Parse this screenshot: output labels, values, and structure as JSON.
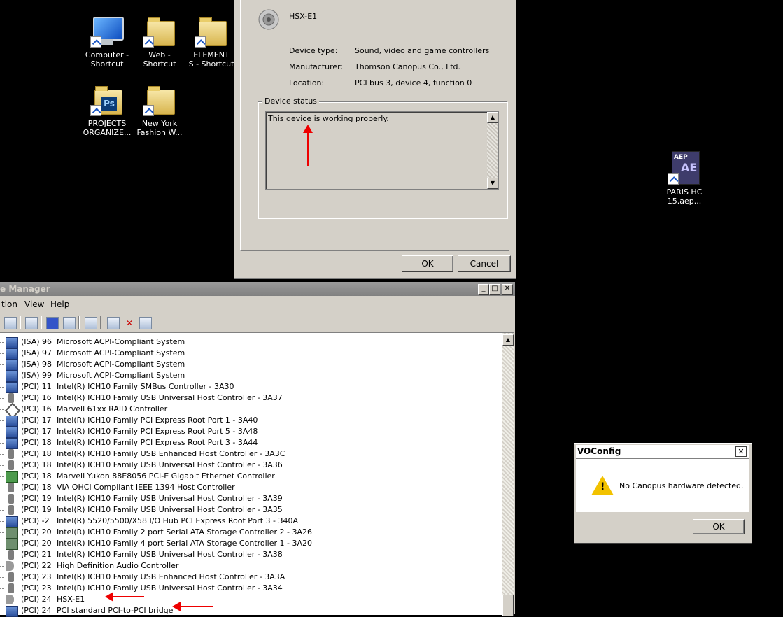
{
  "desktop": {
    "icons": [
      {
        "label": "Computer -\nShortcut",
        "icon": "computer-icon"
      },
      {
        "label": "Web -\nShortcut",
        "icon": "folder-icon"
      },
      {
        "label": "ELEMENT\nS - Shortcut",
        "icon": "folder-icon"
      },
      {
        "label": "PROJECTS\nORGANIZE...",
        "icon": "photoshop-folder-icon"
      },
      {
        "label": "New York\nFashion W...",
        "icon": "folder-icon"
      },
      {
        "label": "PARIS HC\n15.aep...",
        "icon": "after-effects-file-icon",
        "badge_top": "AEP",
        "badge_main": "AE"
      }
    ]
  },
  "properties_dialog": {
    "device_name": "HSX-E1",
    "rows": [
      {
        "key": "Device type:",
        "value": "Sound, video and game controllers"
      },
      {
        "key": "Manufacturer:",
        "value": "Thomson Canopus Co., Ltd."
      },
      {
        "key": "Location:",
        "value": "PCI bus 3, device 4, function 0"
      }
    ],
    "status_group_label": "Device status",
    "status_text": "This device is working properly.",
    "ok_label": "OK",
    "cancel_label": "Cancel"
  },
  "device_manager": {
    "title": "e Manager",
    "menu": [
      "tion",
      "View",
      "Help"
    ],
    "window_buttons": {
      "minimize": "_",
      "maximize": "□",
      "close": "✕"
    },
    "rows": [
      {
        "bus": "(ISA) 96",
        "name": "Microsoft ACPI-Compliant System",
        "icon": "chip"
      },
      {
        "bus": "(ISA) 97",
        "name": "Microsoft ACPI-Compliant System",
        "icon": "chip"
      },
      {
        "bus": "(ISA) 98",
        "name": "Microsoft ACPI-Compliant System",
        "icon": "chip"
      },
      {
        "bus": "(ISA) 99",
        "name": "Microsoft ACPI-Compliant System",
        "icon": "chip"
      },
      {
        "bus": "(PCI) 11",
        "name": "Intel(R) ICH10 Family SMBus Controller - 3A30",
        "icon": "chip"
      },
      {
        "bus": "(PCI) 16",
        "name": "Intel(R) ICH10 Family USB Universal Host Controller - 3A37",
        "icon": "usb"
      },
      {
        "bus": "(PCI) 16",
        "name": "Marvell 61xx RAID Controller",
        "icon": "raid"
      },
      {
        "bus": "(PCI) 17",
        "name": "Intel(R) ICH10 Family PCI Express Root Port 1 - 3A40",
        "icon": "chip"
      },
      {
        "bus": "(PCI) 17",
        "name": "Intel(R) ICH10 Family PCI Express Root Port 5 - 3A48",
        "icon": "chip"
      },
      {
        "bus": "(PCI) 18",
        "name": "Intel(R) ICH10 Family PCI Express Root Port 3 - 3A44",
        "icon": "chip"
      },
      {
        "bus": "(PCI) 18",
        "name": "Intel(R) ICH10 Family USB Enhanced Host Controller - 3A3C",
        "icon": "usb"
      },
      {
        "bus": "(PCI) 18",
        "name": "Intel(R) ICH10 Family USB Universal Host Controller - 3A36",
        "icon": "usb"
      },
      {
        "bus": "(PCI) 18",
        "name": "Marvell Yukon 88E8056 PCI-E Gigabit Ethernet Controller",
        "icon": "net"
      },
      {
        "bus": "(PCI) 18",
        "name": "VIA OHCI Compliant IEEE 1394 Host Controller",
        "icon": "usb"
      },
      {
        "bus": "(PCI) 19",
        "name": "Intel(R) ICH10 Family USB Universal Host Controller - 3A39",
        "icon": "usb"
      },
      {
        "bus": "(PCI) 19",
        "name": "Intel(R) ICH10 Family USB Universal Host Controller - 3A35",
        "icon": "usb"
      },
      {
        "bus": "(PCI) -2",
        "name": "Intel(R) 5520/5500/X58 I/O Hub PCI Express Root Port 3 - 340A",
        "icon": "chip"
      },
      {
        "bus": "(PCI) 20",
        "name": "Intel(R) ICH10 Family 2 port Serial ATA Storage Controller 2 - 3A26",
        "icon": "sata"
      },
      {
        "bus": "(PCI) 20",
        "name": "Intel(R) ICH10 Family 4 port Serial ATA Storage Controller 1 - 3A20",
        "icon": "sata"
      },
      {
        "bus": "(PCI) 21",
        "name": "Intel(R) ICH10 Family USB Universal Host Controller - 3A38",
        "icon": "usb"
      },
      {
        "bus": "(PCI) 22",
        "name": "High Definition Audio Controller",
        "icon": "snd"
      },
      {
        "bus": "(PCI) 23",
        "name": "Intel(R) ICH10 Family USB Enhanced Host Controller - 3A3A",
        "icon": "usb"
      },
      {
        "bus": "(PCI) 23",
        "name": "Intel(R) ICH10 Family USB Universal Host Controller - 3A34",
        "icon": "usb"
      },
      {
        "bus": "(PCI) 24",
        "name": "HSX-E1",
        "icon": "snd"
      },
      {
        "bus": "(PCI) 24",
        "name": "PCI standard PCI-to-PCI bridge",
        "icon": "chip"
      }
    ]
  },
  "voconfig": {
    "title": "VOConfig",
    "close": "✕",
    "message": "No Canopus hardware detected.",
    "ok_label": "OK"
  },
  "colors": {
    "annotation_arrow": "#e00000",
    "desktop": "#000000",
    "dialog": "#d4d0c8"
  }
}
